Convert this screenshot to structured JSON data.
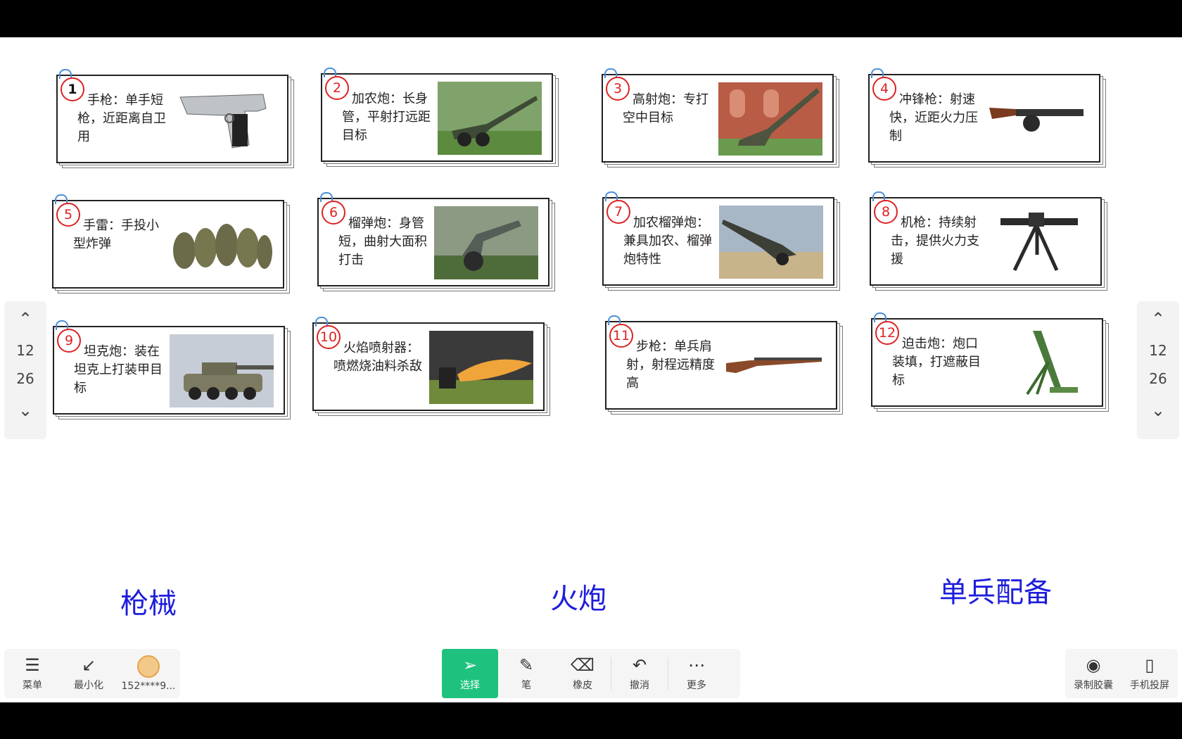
{
  "cards": [
    {
      "num": "1",
      "text": "手枪：单手短枪，近距离自卫用"
    },
    {
      "num": "2",
      "text": "加农炮：长身管，平射打远距目标"
    },
    {
      "num": "3",
      "text": "高射炮：专打空中目标"
    },
    {
      "num": "4",
      "text": "冲锋枪：射速快，近距火力压制"
    },
    {
      "num": "5",
      "text": "手雷：手投小型炸弹"
    },
    {
      "num": "6",
      "text": "榴弹炮：身管短，曲射大面积打击"
    },
    {
      "num": "7",
      "text": "加农榴弹炮：兼具加农、榴弹炮特性"
    },
    {
      "num": "8",
      "text": "机枪：持续射击，提供火力支援"
    },
    {
      "num": "9",
      "text": "坦克炮：装在坦克上打装甲目标"
    },
    {
      "num": "10",
      "text": "火焰喷射器：喷燃烧油料杀敌"
    },
    {
      "num": "11",
      "text": "步枪：单兵肩射，射程远精度高"
    },
    {
      "num": "12",
      "text": "迫击炮：炮口装填，打遮蔽目标"
    }
  ],
  "categories": {
    "guns": "枪械",
    "artillery": "火炮",
    "infantry": "单兵配备"
  },
  "pager": {
    "current": "12",
    "total": "26"
  },
  "toolbar": {
    "menu": "菜单",
    "minimize": "最小化",
    "user": "152****9...",
    "select": "选择",
    "pen": "笔",
    "eraser": "橡皮",
    "undo": "撤消",
    "more": "更多",
    "record": "录制胶囊",
    "cast": "手机投屏"
  }
}
